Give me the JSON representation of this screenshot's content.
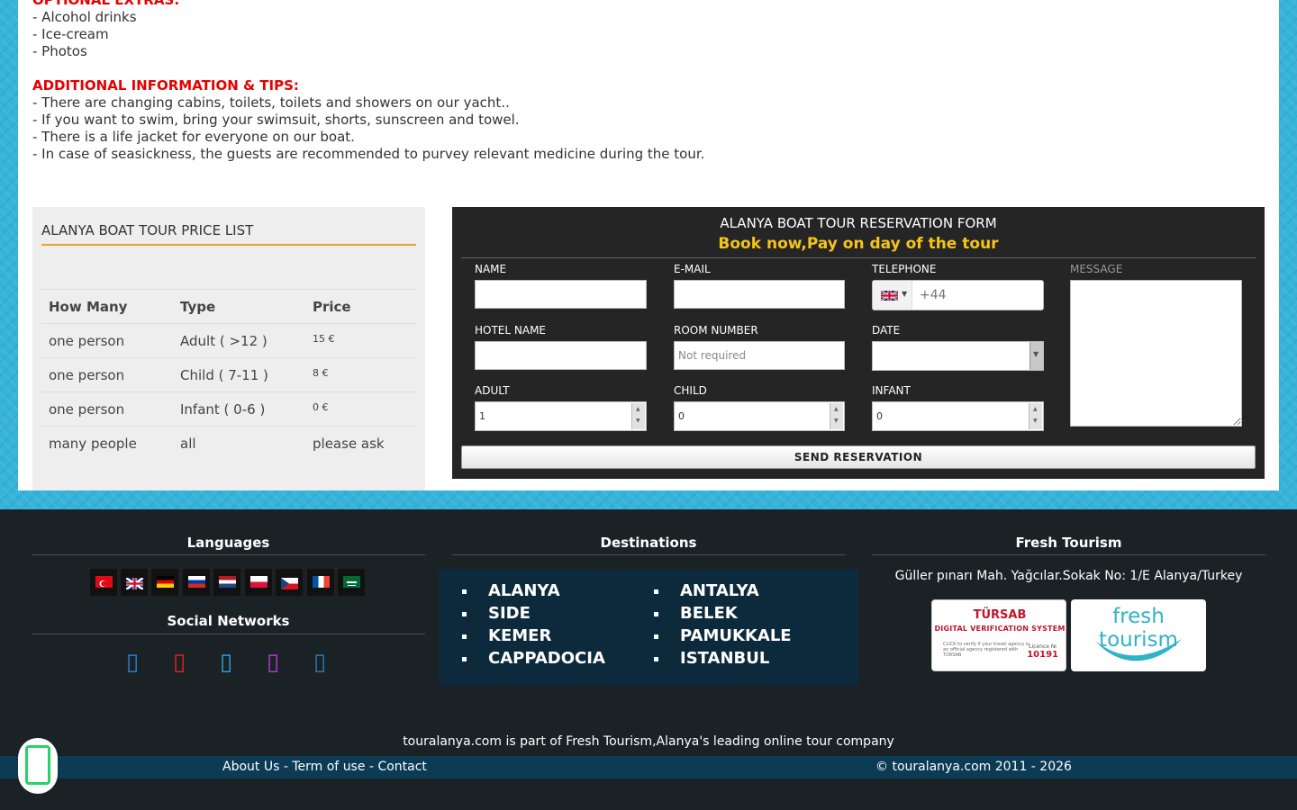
{
  "tour_info": {
    "optional_extras_heading": "OPTIONAL EXTRAS:",
    "optional_extras": [
      "- Alcohol drinks",
      "- Ice-cream",
      "- Photos"
    ],
    "additional_heading": "ADDITIONAL INFORMATION & TIPS:",
    "additional_items": [
      "- There are changing cabins, toilets, toilets and showers on our yacht..",
      "- If you want to swim, bring your swimsuit, shorts, sunscreen and towel.",
      "- There is a life jacket for everyone on our boat.",
      "- In case of seasickness, the guests are recommended to purvey relevant medicine during the tour."
    ]
  },
  "price_list": {
    "title": "ALANYA BOAT TOUR PRICE LIST",
    "headers": [
      "How Many",
      "Type",
      "Price"
    ],
    "rows": [
      {
        "how_many": "one person",
        "type": "Adult ( >12 )",
        "price": "15 €"
      },
      {
        "how_many": "one person",
        "type": "Child ( 7-11 )",
        "price": "8 €"
      },
      {
        "how_many": "one person",
        "type": "Infant ( 0-6 )",
        "price": "0 €"
      },
      {
        "how_many": "many people",
        "type": "all",
        "price": "please ask"
      }
    ]
  },
  "reservation_form": {
    "title": "ALANYA BOAT TOUR RESERVATION FORM",
    "subtitle": "Book now,Pay on day of the tour",
    "labels": {
      "name": "NAME",
      "email": "E-MAIL",
      "telephone": "TELEPHONE",
      "message": "MESSAGE",
      "hotel": "HOTEL NAME",
      "room": "ROOM NUMBER",
      "date": "DATE",
      "adult": "ADULT",
      "child": "CHILD",
      "infant": "INFANT"
    },
    "room_placeholder": "Not required",
    "phone_code": "+44",
    "phone_country_icon": "uk-flag",
    "adult_value": "1",
    "child_value": "0",
    "infant_value": "0",
    "send_label": "SEND RESERVATION"
  },
  "footer": {
    "languages_title": "Languages",
    "language_flags": [
      "turkey-flag",
      "uk-flag",
      "germany-flag",
      "russia-flag",
      "netherlands-flag",
      "poland-flag",
      "czech-flag",
      "france-flag",
      "saudi-flag"
    ],
    "social_title": "Social Networks",
    "social_icons": [
      "facebook-icon",
      "youtube-icon",
      "twitter-icon",
      "instagram-icon",
      "linkedin-icon"
    ],
    "destinations_title": "Destinations",
    "destinations_left": [
      "ALANYA",
      "SIDE",
      "KEMER",
      "CAPPADOCIA"
    ],
    "destinations_right": [
      "ANTALYA",
      "BELEK",
      "PAMUKKALE",
      "ISTANBUL"
    ],
    "company_title": "Fresh Tourism",
    "address": "Güller pınarı Mah. Yağcılar.Sokak No: 1/E Alanya/Turkey",
    "tursab": {
      "title": "TÜRSAB",
      "subtitle": "DIGITAL VERIFICATION SYSTEM",
      "small_text": "CLICK to verify if your travel agency is an official agency registered with TÜRSAB",
      "licence_label": "Licence №",
      "licence_number": "10191"
    },
    "fresh_logo_text": "fresh tourism",
    "tagline": "touralanya.com is  part of Fresh Tourism,Alanya's leading online tour company",
    "links": [
      "About Us",
      "Term of use",
      "Contact"
    ],
    "copyright": "© touralanya.com 2011 - 2026"
  },
  "colors": {
    "accent_red": "#e60000",
    "accent_yellow": "#f5c518",
    "frame_turquoise": "#36b3d8",
    "footer_dark": "#1a2226",
    "destinations_bg": "#0d2a3d"
  }
}
